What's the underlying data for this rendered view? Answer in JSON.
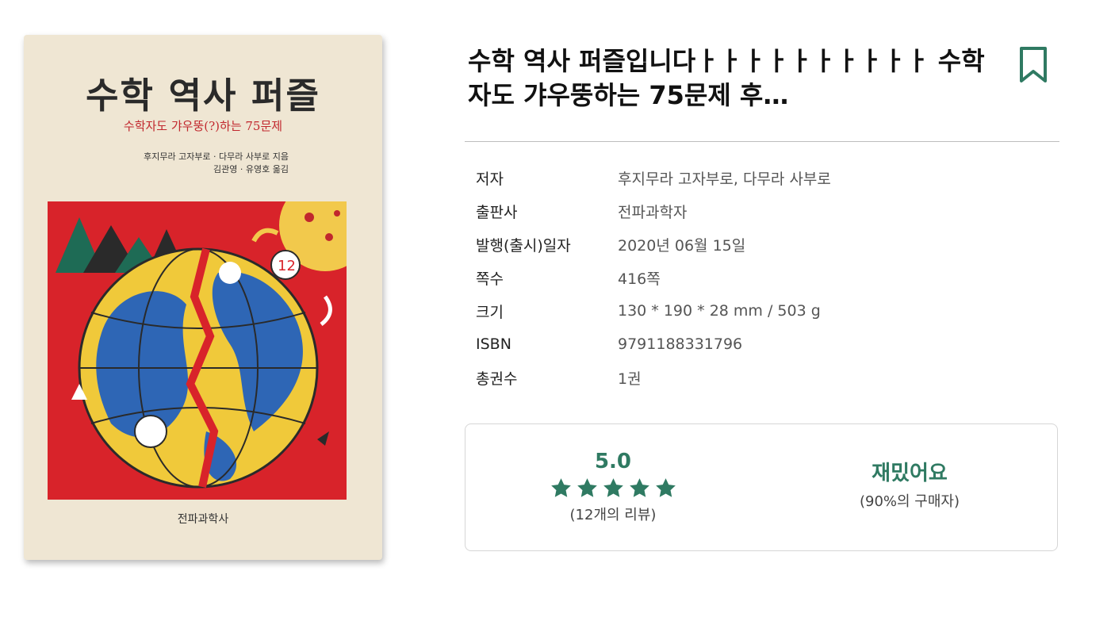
{
  "cover": {
    "title": "수학 역사 퍼즐",
    "subtitle": "수학자도 갸우뚱(?)하는 75문제",
    "authors_line1": "후지무라 고자부로 · 다무라 사부로  지음",
    "authors_line2": "김관영 · 유영호  옮김",
    "publisher": "전파과학사"
  },
  "book": {
    "title": "수학 역사 퍼즐입니다ㅏㅏㅏㅏㅏㅏㅏㅏㅏㅏ 수학자도 갸우뚱하는 75문제 후…"
  },
  "details": [
    {
      "label": "저자",
      "value": "후지무라 고자부로, 다무라 사부로"
    },
    {
      "label": "출판사",
      "value": "전파과학자"
    },
    {
      "label": "발행(출시)일자",
      "value": "2020년 06월 15일"
    },
    {
      "label": "쪽수",
      "value": "416쪽"
    },
    {
      "label": "크기",
      "value": "130 * 190 * 28 mm / 503 g"
    },
    {
      "label": "ISBN",
      "value": "9791188331796"
    },
    {
      "label": "총권수",
      "value": "1권"
    }
  ],
  "rating": {
    "score": "5.0",
    "stars": 5,
    "review_count": "(12개의 리뷰)",
    "opinion": "재밌어요",
    "opinion_share": "(90%의 구매자)"
  },
  "colors": {
    "accent": "#2f7a62",
    "cover_bg": "#efe6d3",
    "cover_art_red": "#d8232a"
  },
  "icons": {
    "bookmark": "bookmark-icon",
    "star": "star-icon"
  }
}
